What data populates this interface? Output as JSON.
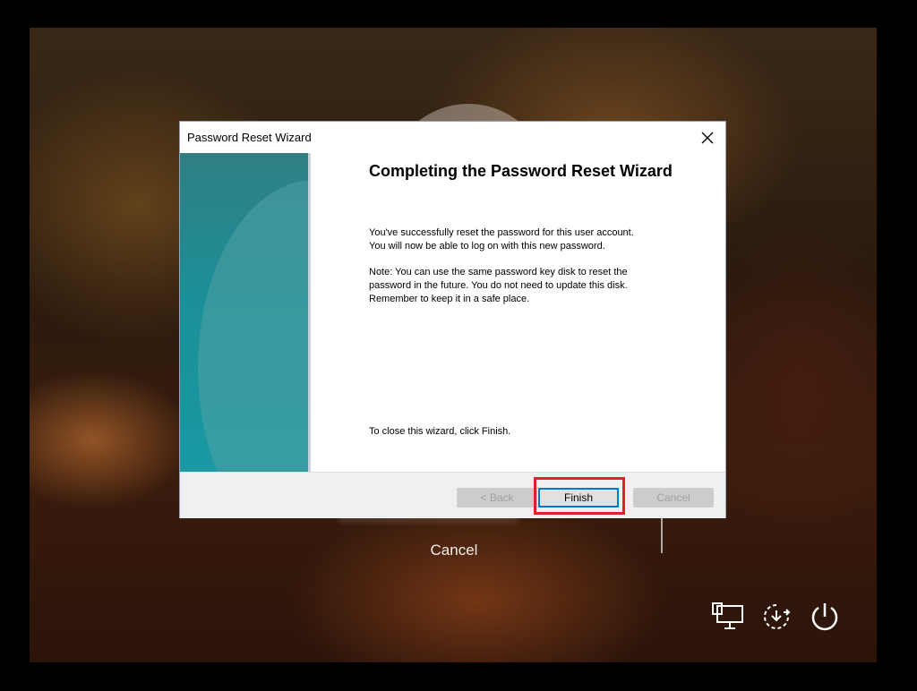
{
  "lock_screen": {
    "cancel_label": "Cancel",
    "tray_icons": [
      "network-icon",
      "accessibility-icon",
      "power-icon"
    ]
  },
  "dialog": {
    "title": "Password Reset Wizard",
    "heading": "Completing the Password Reset Wizard",
    "paragraph1_line1": "You've successfully reset the password for this user account.",
    "paragraph1_line2": "You will now be able to log on with this new password.",
    "paragraph2_line1": "Note: You can use the same password key disk to reset the",
    "paragraph2_line2": "password in the future. You do not need to update this disk.",
    "paragraph2_line3": "Remember to keep it in a safe place.",
    "close_hint": "To close this wizard, click Finish.",
    "buttons": {
      "back": "< Back",
      "finish": "Finish",
      "cancel": "Cancel"
    },
    "highlight_color": "#e0202a",
    "accent_color": "#0078d7"
  }
}
